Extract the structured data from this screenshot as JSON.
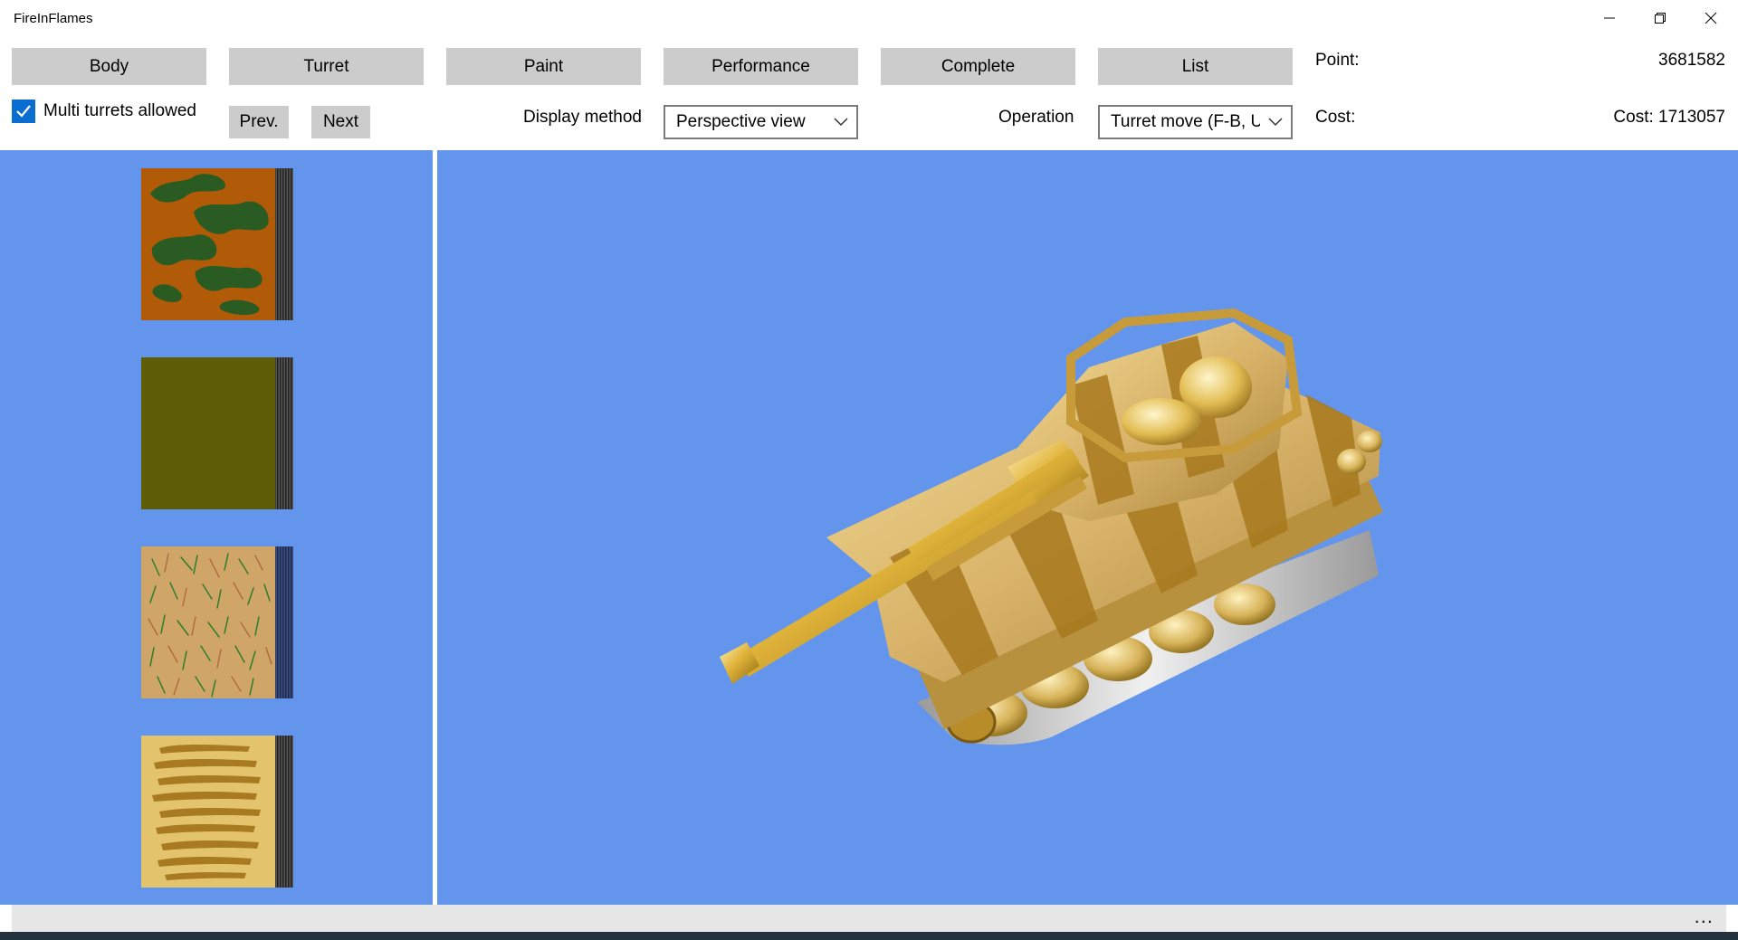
{
  "app": {
    "title": "FireInFlames"
  },
  "window_controls": {
    "minimize_icon": "minimize-icon",
    "restore_icon": "restore-icon",
    "close_icon": "close-icon"
  },
  "toolbar": {
    "tabs": [
      {
        "label": "Body"
      },
      {
        "label": "Turret"
      },
      {
        "label": "Paint"
      },
      {
        "label": "Performance"
      },
      {
        "label": "Complete"
      },
      {
        "label": "List"
      }
    ],
    "multi_turrets": {
      "label": "Multi turrets allowed",
      "checked": true
    },
    "prev_label": "Prev.",
    "next_label": "Next",
    "display_method": {
      "label": "Display method",
      "value": "Perspective view"
    },
    "operation": {
      "label": "Operation",
      "value": "Turret move (F-B, U"
    }
  },
  "stats": {
    "point_label": "Point:",
    "point_value": "3681582",
    "cost_label": "Cost:",
    "cost_value": "Cost: 1713057"
  },
  "paint_swatches": [
    {
      "name": "green-camo-on-rust",
      "colors": [
        "#b15a08",
        "#2a5b22"
      ]
    },
    {
      "name": "solid-olive",
      "colors": [
        "#5e5c05"
      ]
    },
    {
      "name": "green-brown-scribble-on-tan",
      "colors": [
        "#cfa668",
        "#2f7c2f",
        "#b36b42"
      ]
    },
    {
      "name": "brown-stripes-on-yellow",
      "colors": [
        "#e3c36c",
        "#a87a22"
      ]
    }
  ],
  "colors": {
    "background": "#6495ed",
    "button": "#cccccc",
    "accent": "#0a6ed1"
  },
  "statusbar": {
    "more": "..."
  }
}
